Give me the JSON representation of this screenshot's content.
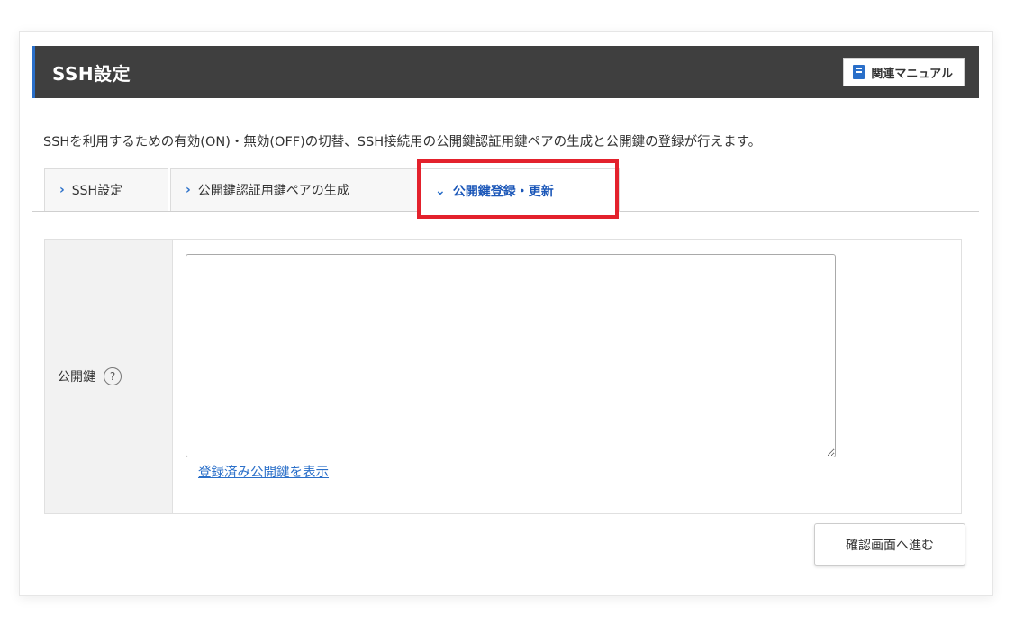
{
  "header": {
    "title": "SSH設定",
    "manual_label": "関連マニュアル",
    "manual_icon": "book-icon"
  },
  "description": "SSHを利用するための有効(ON)・無効(OFF)の切替、SSH接続用の公開鍵認証用鍵ペアの生成と公開鍵の登録が行えます。",
  "tabs": [
    {
      "label": "SSH設定",
      "icon": "chevron-right-icon",
      "active": false
    },
    {
      "label": "公開鍵認証用鍵ペアの生成",
      "icon": "chevron-right-icon",
      "active": false
    },
    {
      "label": "公開鍵登録・更新",
      "icon": "chevron-down-icon",
      "active": true
    }
  ],
  "form": {
    "public_key_label": "公開鍵",
    "help_icon": "?",
    "public_key_value": "",
    "show_registered_link": "登録済み公開鍵を表示"
  },
  "confirm_button": "確認画面へ進む",
  "colors": {
    "header_bg": "#3f3f3f",
    "accent": "#2a6fc9",
    "highlight": "#e3212c"
  }
}
